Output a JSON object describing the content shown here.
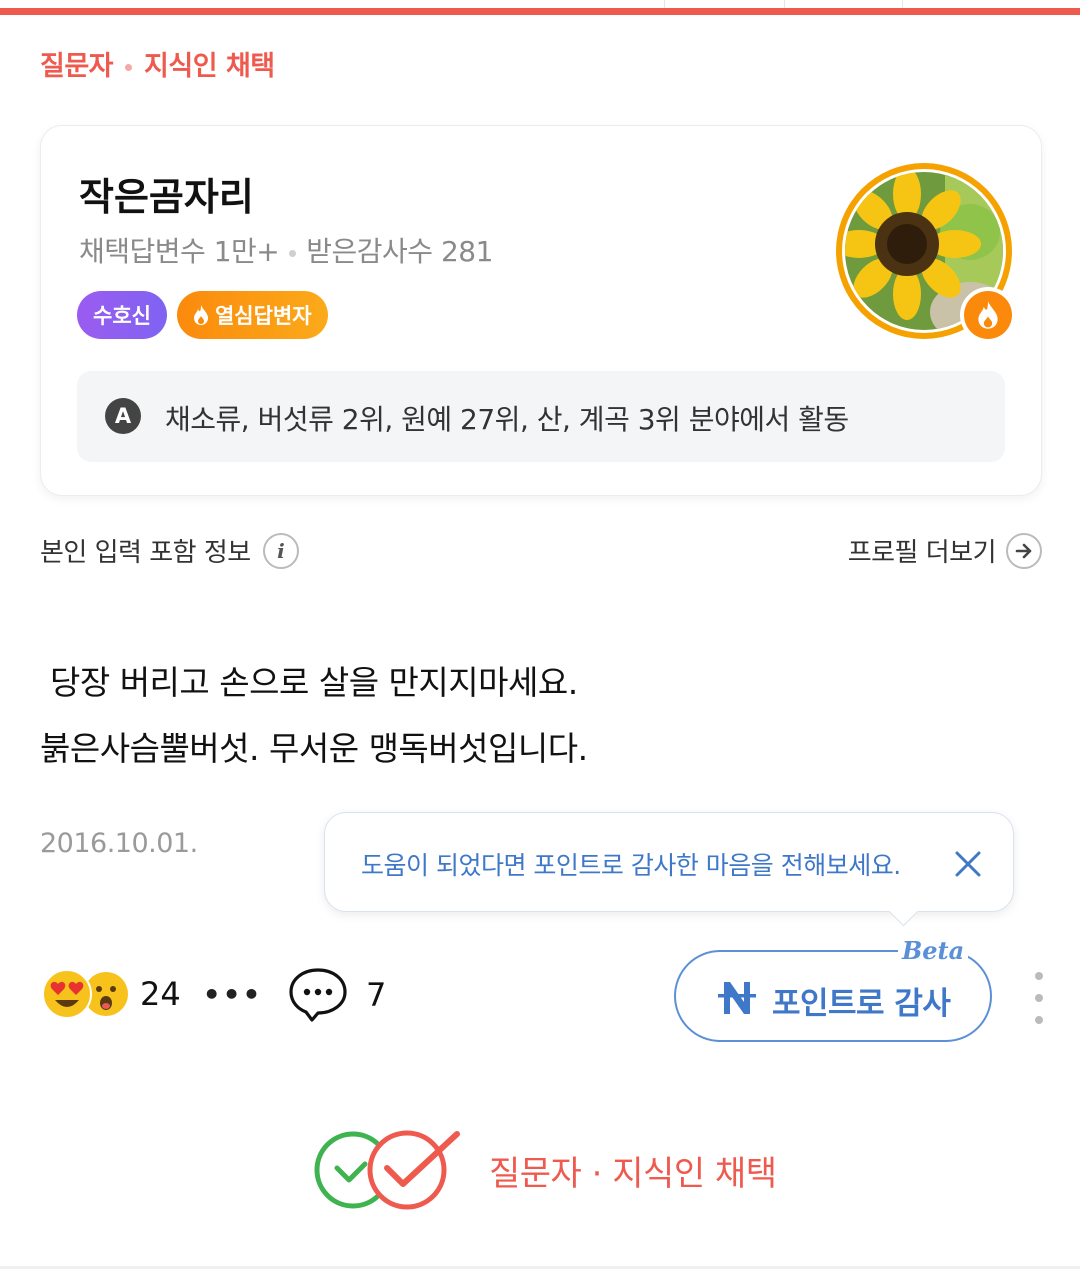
{
  "header": {
    "label_part1": "질문자",
    "label_part2": "지식인 채택"
  },
  "profile": {
    "name": "작은곰자리",
    "stats_adopted": "채택답변수 1만+",
    "stats_thanks": "받은감사수 281",
    "badges": [
      "수호신",
      "열심답변자"
    ],
    "activity_icon": "A",
    "activity_text": "채소류, 버섯류 2위, 원예 27위, 산, 계곡 3위 분야에서 활동",
    "avatar_icon": "sunflower-avatar",
    "fire_icon": "fire-icon"
  },
  "info": {
    "self_input": "본인 입력 포함 정보",
    "more_profile": "프로필 더보기"
  },
  "answer": {
    "line1": " 당장 버리고 손으로 살을 만지지마세요.",
    "line2": "붉은사슴뿔버섯. 무서운 맹독버섯입니다."
  },
  "date": "2016.10.01.",
  "tooltip": {
    "text": "도움이 되었다면 포인트로 감사한 마음을 전해보세요."
  },
  "reactions": {
    "count": "24",
    "more": "•••",
    "comment_count": "7"
  },
  "thanks_button": {
    "label": "포인트로 감사",
    "beta": "Beta"
  },
  "adopt": {
    "label": "질문자 · 지식인 채택"
  },
  "colors": {
    "accent_red": "#ef5a4f",
    "blue": "#3f78c8",
    "purple": "#8c5ff1",
    "orange": "#fb8a0c"
  }
}
